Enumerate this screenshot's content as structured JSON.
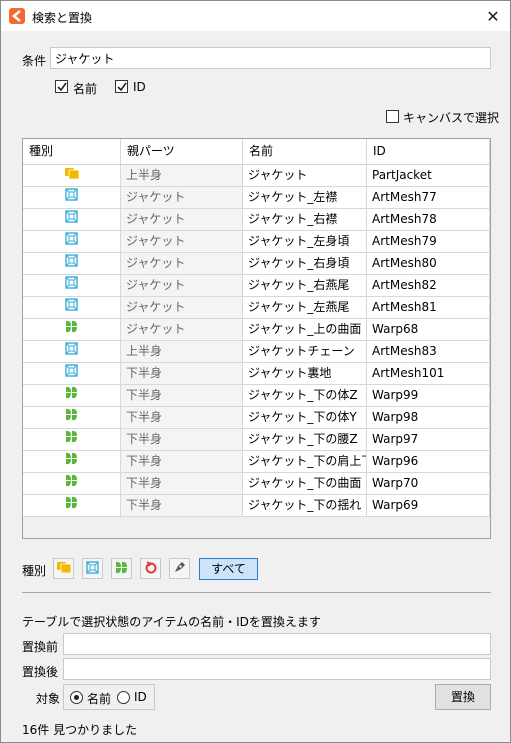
{
  "window": {
    "title": "検索と置換",
    "close": "✕"
  },
  "search": {
    "condition_label": "条件",
    "condition_value": "ジャケット",
    "check_name_label": "名前",
    "check_id_label": "ID",
    "check_name_checked": true,
    "check_id_checked": true,
    "canvas_select_label": "キャンバスで選択",
    "canvas_select_checked": false
  },
  "table": {
    "headers": [
      "種別",
      "親パーツ",
      "名前",
      "ID"
    ],
    "rows": [
      {
        "type": "folder",
        "parent": "上半身",
        "name": "ジャケット",
        "id": "PartJacket"
      },
      {
        "type": "artmesh",
        "parent": "ジャケット",
        "name": "ジャケット_左襟",
        "id": "ArtMesh77"
      },
      {
        "type": "artmesh",
        "parent": "ジャケット",
        "name": "ジャケット_右襟",
        "id": "ArtMesh78"
      },
      {
        "type": "artmesh",
        "parent": "ジャケット",
        "name": "ジャケット_左身頃",
        "id": "ArtMesh79"
      },
      {
        "type": "artmesh",
        "parent": "ジャケット",
        "name": "ジャケット_右身頃",
        "id": "ArtMesh80"
      },
      {
        "type": "artmesh",
        "parent": "ジャケット",
        "name": "ジャケット_右燕尾",
        "id": "ArtMesh82"
      },
      {
        "type": "artmesh",
        "parent": "ジャケット",
        "name": "ジャケット_左燕尾",
        "id": "ArtMesh81"
      },
      {
        "type": "warp",
        "parent": "ジャケット",
        "name": "ジャケット_上の曲面",
        "id": "Warp68"
      },
      {
        "type": "artmesh",
        "parent": "上半身",
        "name": "ジャケットチェーン",
        "id": "ArtMesh83"
      },
      {
        "type": "artmesh",
        "parent": "下半身",
        "name": "ジャケット裏地",
        "id": "ArtMesh101"
      },
      {
        "type": "warp",
        "parent": "下半身",
        "name": "ジャケット_下の体Z",
        "id": "Warp99"
      },
      {
        "type": "warp",
        "parent": "下半身",
        "name": "ジャケット_下の体Y",
        "id": "Warp98"
      },
      {
        "type": "warp",
        "parent": "下半身",
        "name": "ジャケット_下の腰Z",
        "id": "Warp97"
      },
      {
        "type": "warp",
        "parent": "下半身",
        "name": "ジャケット_下の肩上下",
        "id": "Warp96"
      },
      {
        "type": "warp",
        "parent": "下半身",
        "name": "ジャケット_下の曲面",
        "id": "Warp70"
      },
      {
        "type": "warp",
        "parent": "下半身",
        "name": "ジャケット_下の揺れ",
        "id": "Warp69"
      }
    ]
  },
  "filter": {
    "label": "種別",
    "types": [
      "folder-icon",
      "artmesh-icon",
      "warp-icon",
      "rotation-icon",
      "pen-icon"
    ],
    "all_label": "すべて"
  },
  "replace": {
    "description": "テーブルで選択状態のアイテムの名前・IDを置換えます",
    "before_label": "置換前",
    "before_value": "",
    "after_label": "置換後",
    "after_value": "",
    "target_label": "対象",
    "target_name_label": "名前",
    "target_id_label": "ID",
    "target_selected": "name",
    "replace_button": "置換"
  },
  "status": {
    "result": "16件 見つかりました"
  },
  "colors": {
    "folder": "#f5b800",
    "artmesh": "#3aaedc",
    "warp": "#5cb83a",
    "rotation": "#e03a3a",
    "accent_button": "#cce4f7",
    "accent_border": "#2b7bd1"
  }
}
